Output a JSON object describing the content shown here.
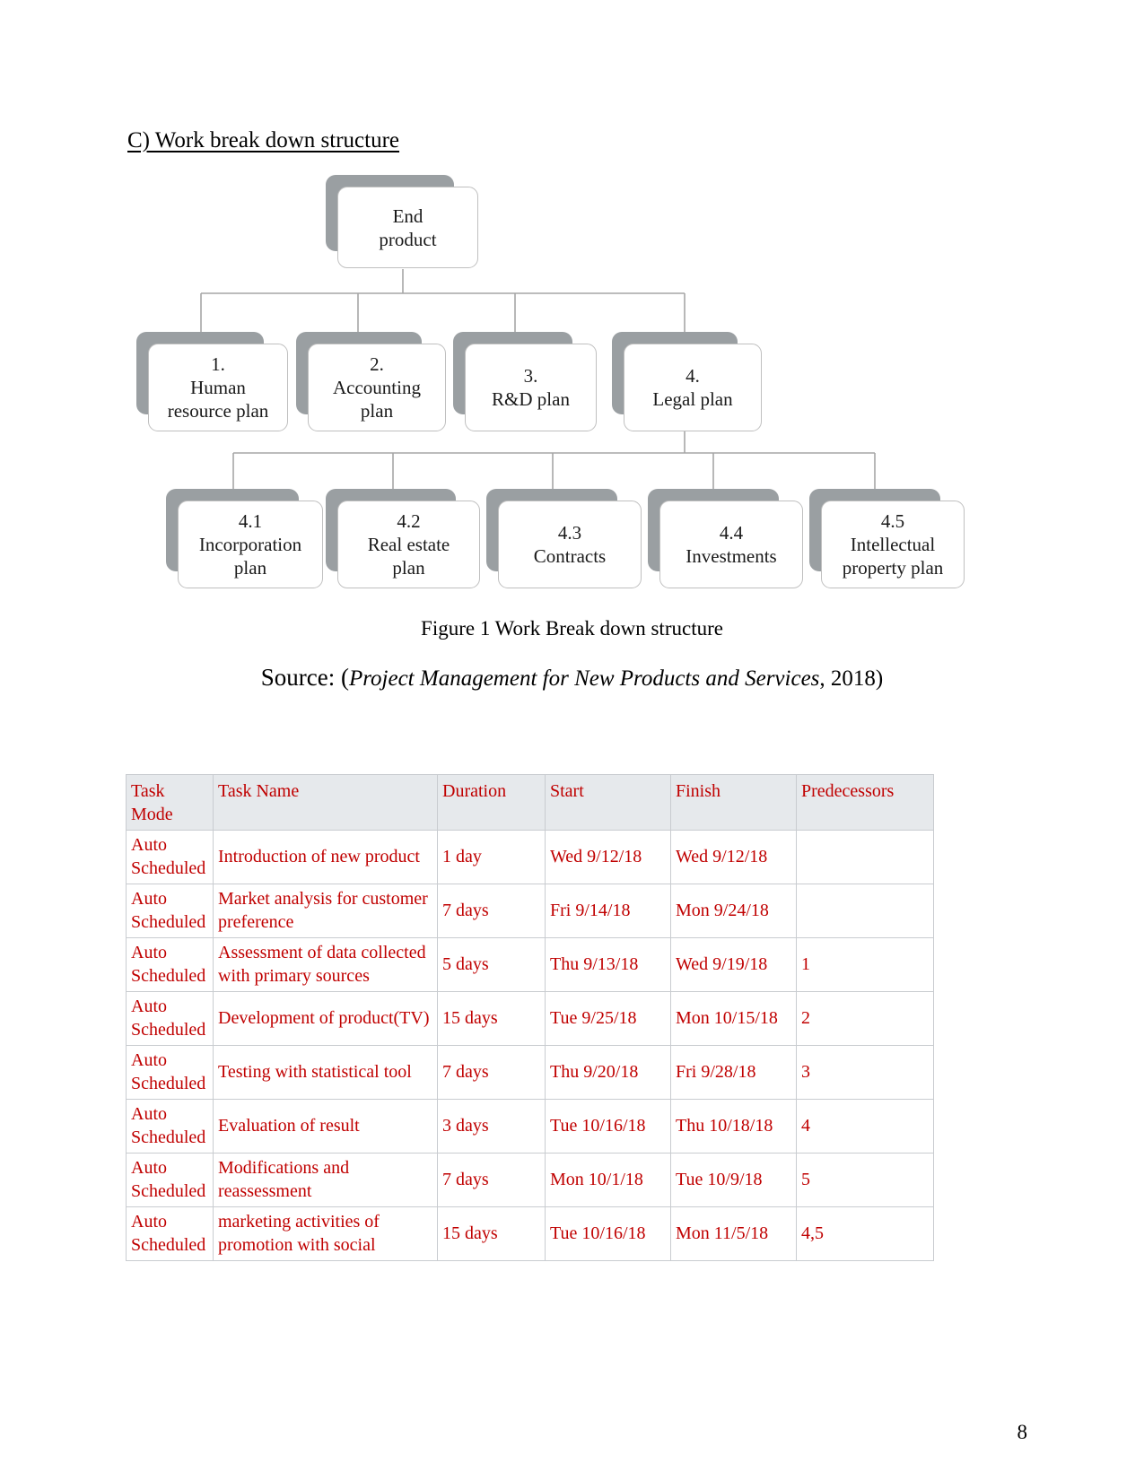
{
  "document": {
    "heading": "C) Work break down structure",
    "figure_caption": "Figure 1 Work Break down structure",
    "source": {
      "prefix": "Source: (",
      "title_italic": "Project Management for New Products and Services",
      "suffix": ", 2018)"
    },
    "page_number": "8"
  },
  "wbs": {
    "root": {
      "line1": "End",
      "line2": "product"
    },
    "level2": [
      {
        "line1": "1.",
        "line2": "Human",
        "line3": "resource plan"
      },
      {
        "line1": "2.",
        "line2": "Accounting",
        "line3": "plan"
      },
      {
        "line1": "3.",
        "line2": "R&D plan",
        "line3": ""
      },
      {
        "line1": "4.",
        "line2": "Legal plan",
        "line3": ""
      }
    ],
    "level3": [
      {
        "line1": "4.1",
        "line2": "Incorporation",
        "line3": "plan"
      },
      {
        "line1": "4.2",
        "line2": "Real estate",
        "line3": "plan"
      },
      {
        "line1": "4.3",
        "line2": "Contracts",
        "line3": ""
      },
      {
        "line1": "4.4",
        "line2": "Investments",
        "line3": ""
      },
      {
        "line1": "4.5",
        "line2": "Intellectual",
        "line3": "property plan"
      }
    ],
    "colors": {
      "shadow": "#9a9fa2",
      "card_border": "#bfbfbf",
      "connector": "#a6a6a6"
    }
  },
  "table": {
    "header_background": "#e6e9ec",
    "text_color": "#C00000",
    "columns": [
      "Task Mode",
      "Task Name",
      "Duration",
      "Start",
      "Finish",
      "Predecessors"
    ],
    "columns_split": [
      {
        "line1": "Task",
        "line2": "Mode"
      },
      {
        "line1": "Task Name",
        "line2": ""
      },
      {
        "line1": "Duration",
        "line2": ""
      },
      {
        "line1": "Start",
        "line2": ""
      },
      {
        "line1": "Finish",
        "line2": ""
      },
      {
        "line1": "Predecessors",
        "line2": ""
      }
    ],
    "rows": [
      {
        "mode": "Auto Scheduled",
        "name": "Introduction of new product",
        "duration": "1 day",
        "start": "Wed 9/12/18",
        "finish": "Wed 9/12/18",
        "predecessors": ""
      },
      {
        "mode": "Auto Scheduled",
        "name": "Market analysis for customer preference",
        "duration": "7 days",
        "start": "Fri 9/14/18",
        "finish": "Mon 9/24/18",
        "predecessors": ""
      },
      {
        "mode": "Auto Scheduled",
        "name": "Assessment of data collected with primary sources",
        "duration": "5 days",
        "start": "Thu 9/13/18",
        "finish": "Wed 9/19/18",
        "predecessors": "1"
      },
      {
        "mode": "Auto Scheduled",
        "name": "Development of product(TV)",
        "duration": "15 days",
        "start": "Tue 9/25/18",
        "finish": "Mon 10/15/18",
        "predecessors": "2"
      },
      {
        "mode": "Auto Scheduled",
        "name": "Testing with statistical tool",
        "duration": "7 days",
        "start": "Thu 9/20/18",
        "finish": "Fri 9/28/18",
        "predecessors": "3"
      },
      {
        "mode": "Auto Scheduled",
        "name": "Evaluation of result",
        "duration": "3 days",
        "start": "Tue 10/16/18",
        "finish": "Thu 10/18/18",
        "predecessors": "4"
      },
      {
        "mode": "Auto Scheduled",
        "name": "Modifications and reassessment",
        "duration": "7 days",
        "start": "Mon 10/1/18",
        "finish": "Tue 10/9/18",
        "predecessors": "5"
      },
      {
        "mode": "Auto Scheduled",
        "name": "marketing activities of promotion with social",
        "duration": "15 days",
        "start": "Tue 10/16/18",
        "finish": "Mon 11/5/18",
        "predecessors": "4,5"
      }
    ]
  }
}
